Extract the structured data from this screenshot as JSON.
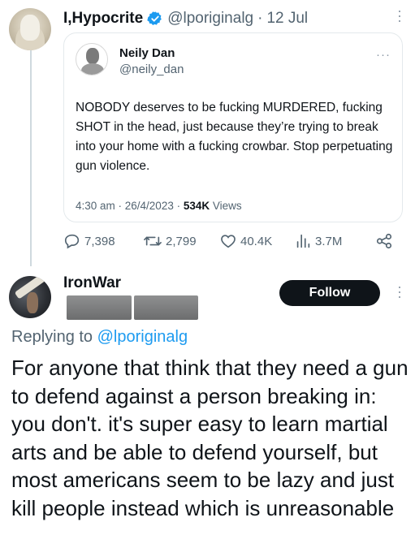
{
  "top_tweet": {
    "display_name": "I,Hypocrite",
    "handle": "@lporiginalg",
    "separator": "·",
    "date": "12 Jul",
    "quoted": {
      "display_name": "Neily Dan",
      "handle": "@neily_dan",
      "text": "NOBODY deserves to be fucking MURDERED, fucking SHOT in the head, just because they’re trying to break into your home with a fucking crowbar. Stop perpetuating gun violence.",
      "timestamp": "4:30 am · 26/4/2023 · ",
      "views_count": "534K",
      "views_label": " Views"
    },
    "actions": {
      "replies": "7,398",
      "retweets": "2,799",
      "likes": "40.4K",
      "views": "3.7M"
    }
  },
  "reply_tweet": {
    "display_name": "IronWar",
    "follow_label": "Follow",
    "replying_prefix": "Replying to ",
    "replying_handle": "@lporiginalg",
    "text": "For anyone that think that they need a gun to defend against a person breaking in: you don't. it's super easy to learn martial arts and be able to defend yourself, but most americans seem to be lazy and just kill people instead which is unreasonable"
  },
  "icons": [
    "verified-badge-icon",
    "more-vertical-icon",
    "more-horizontal-icon",
    "reply-icon",
    "retweet-icon",
    "like-icon",
    "views-icon",
    "share-icon"
  ],
  "colors": {
    "verified": "#1d9bf0",
    "link": "#1d9bf0",
    "muted": "#536471",
    "text": "#0f1419",
    "follow_bg": "#0f1419"
  }
}
